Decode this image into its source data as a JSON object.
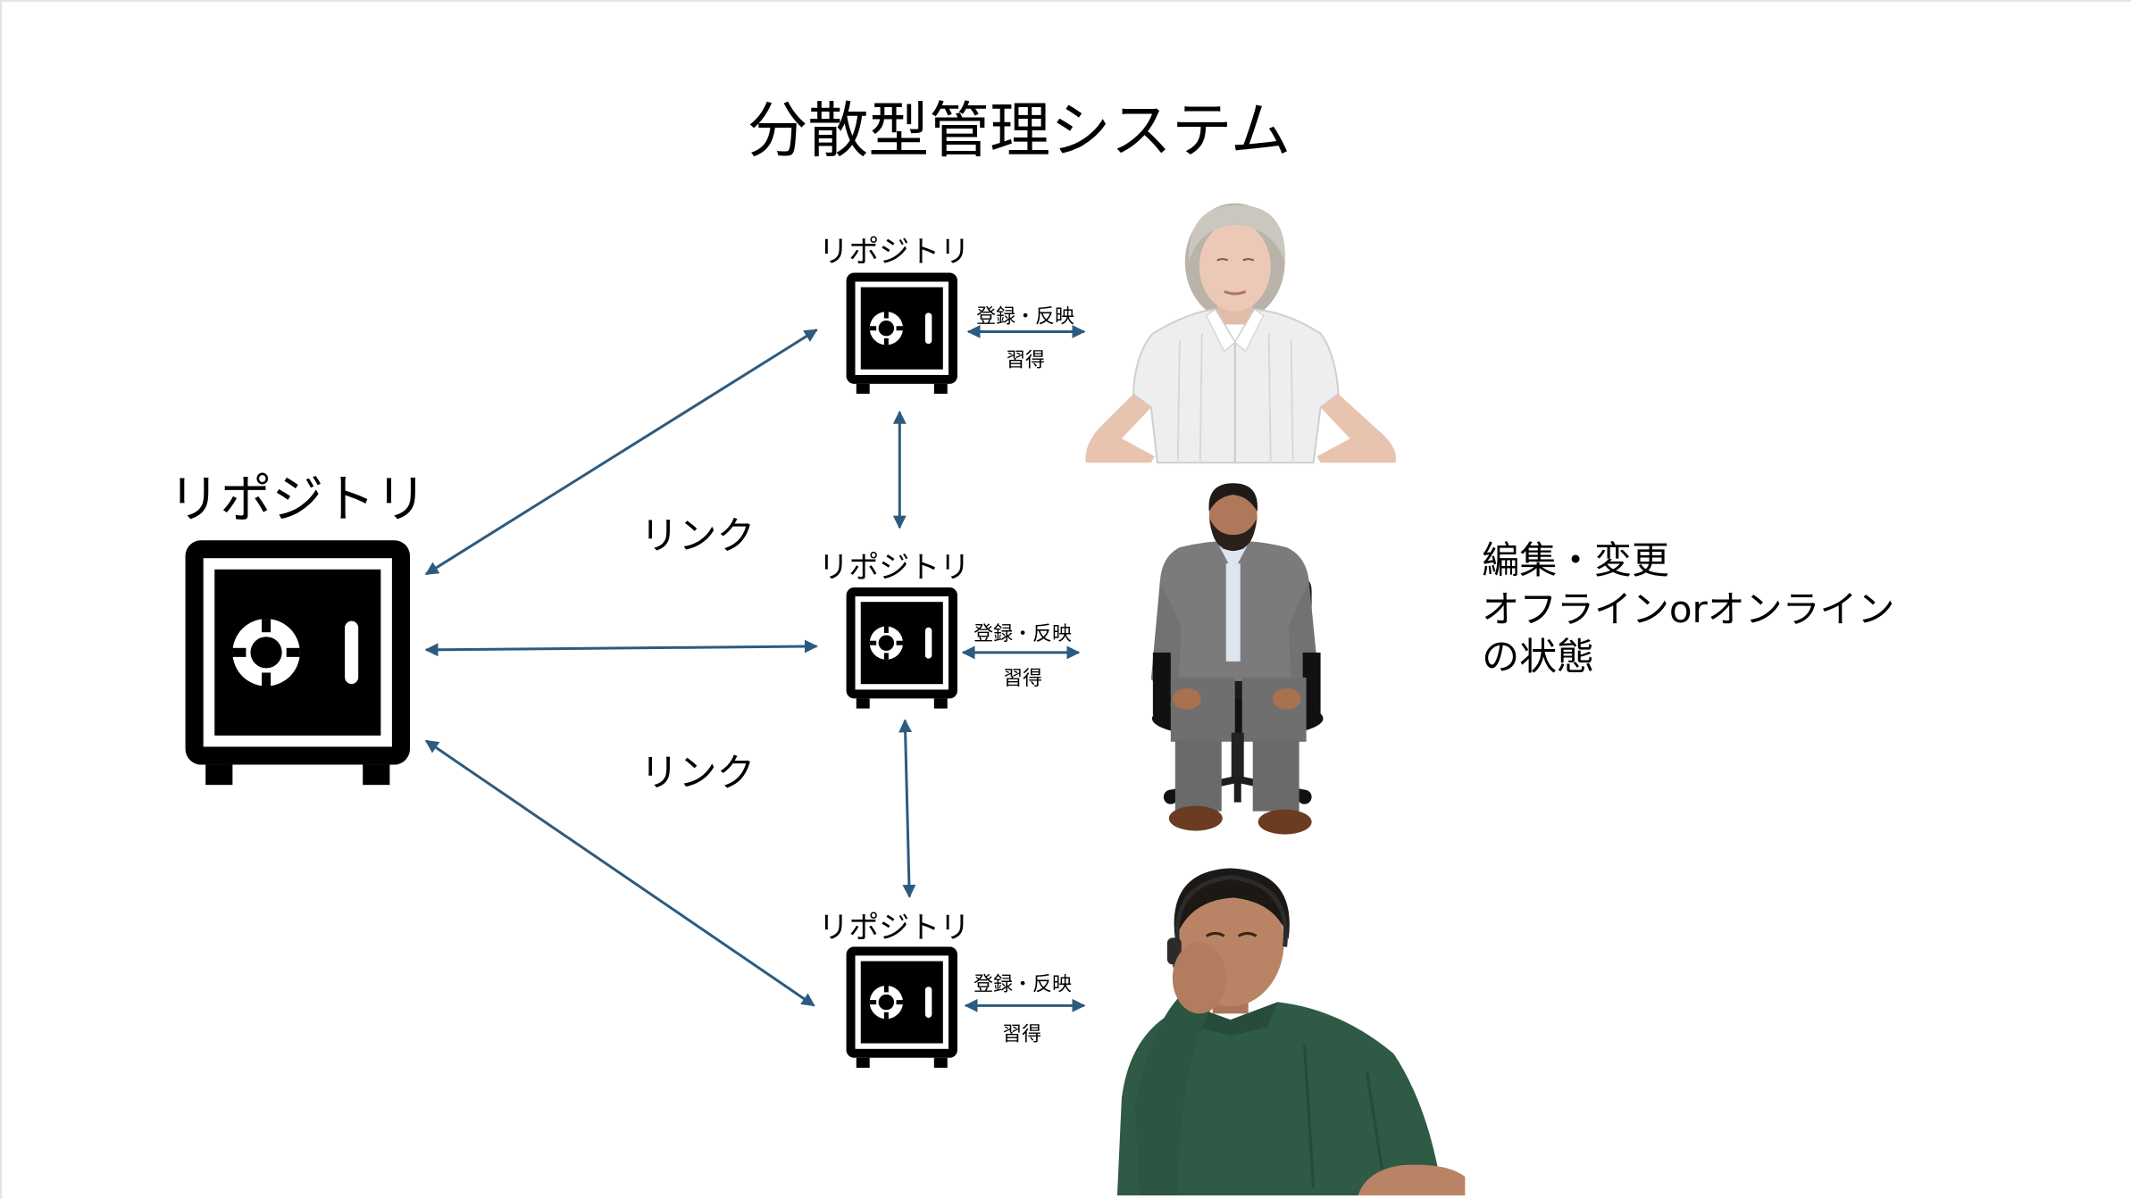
{
  "slide": {
    "title": "分散型管理システム"
  },
  "central_repository": {
    "label": "リポジトリ",
    "icon": "safe-icon"
  },
  "link_labels": [
    "リンク",
    "リンク"
  ],
  "local_repositories": [
    {
      "label": "リポジトリ",
      "icon": "safe-icon",
      "commit_label": "登録・反映",
      "fetch_label": "習得",
      "user_image": "elderly-woman-photo"
    },
    {
      "label": "リポジトリ",
      "icon": "safe-icon",
      "commit_label": "登録・反映",
      "fetch_label": "習得",
      "user_image": "seated-businessman-photo"
    },
    {
      "label": "リポジトリ",
      "icon": "safe-icon",
      "commit_label": "登録・反映",
      "fetch_label": "習得",
      "user_image": "tired-man-with-headset-photo"
    }
  ],
  "side_note": {
    "lines": [
      "編集・変更",
      "オフラインorオンライン",
      "の状態"
    ]
  },
  "colors": {
    "arrow": "#2d5b7f",
    "icon": "#000000",
    "text": "#000000",
    "background": "#ffffff"
  }
}
